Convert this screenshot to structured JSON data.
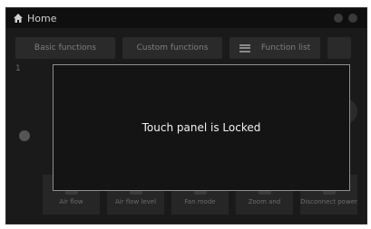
{
  "topbar": {
    "title": "Home"
  },
  "tabs": {
    "basic_label": "Basic functions",
    "custom_label": "Custom functions",
    "function_label": "Function list"
  },
  "background": {
    "left_label": "1"
  },
  "overlay": {
    "message": "Touch panel is Locked"
  },
  "bottom_tiles": [
    {
      "label": "Air flow"
    },
    {
      "label": "Air flow level"
    },
    {
      "label": "Fan mode"
    },
    {
      "label": "Zoom and"
    },
    {
      "label": "Disconnect power"
    }
  ]
}
